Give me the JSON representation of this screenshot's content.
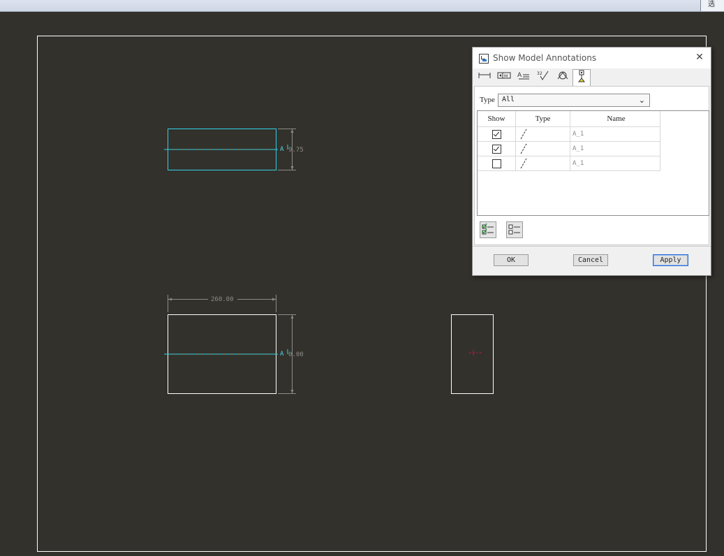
{
  "topbar": {
    "right_text": "选"
  },
  "drawing": {
    "top_view_dim": "9.75",
    "front_view_width_dim": "260.00",
    "front_view_height_dim": "0.00",
    "note_label": "A",
    "colors": {
      "background": "#33312c",
      "border": "#ffffff",
      "highlight": "#2fd2e6",
      "dimension": "#8c8c86",
      "marker": "#b0203c"
    }
  },
  "dialog": {
    "title": "Show Model Annotations",
    "tabs": [
      {
        "icon": "linear-dimension-icon"
      },
      {
        "icon": "geometric-tolerance-icon"
      },
      {
        "icon": "note-icon"
      },
      {
        "icon": "surface-finish-icon"
      },
      {
        "icon": "weld-symbol-icon"
      },
      {
        "icon": "datum-icon",
        "active": true
      }
    ],
    "type_label": "Type",
    "type_value": "All",
    "columns": [
      "Show",
      "Type",
      "Name"
    ],
    "rows": [
      {
        "show": true,
        "type_icon": "datum-axis-icon",
        "name": "A_1"
      },
      {
        "show": true,
        "type_icon": "datum-axis-icon",
        "name": "A_1"
      },
      {
        "show": false,
        "type_icon": "datum-axis-icon",
        "name": "A_1"
      }
    ],
    "select_all_icon": "select-all-icon",
    "deselect_all_icon": "deselect-all-icon",
    "ok_label": "OK",
    "cancel_label": "Cancel",
    "apply_label": "Apply"
  }
}
